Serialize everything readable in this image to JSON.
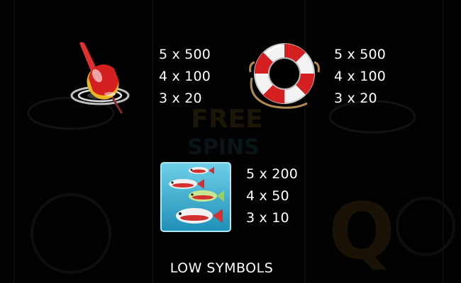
{
  "symbols": [
    {
      "name": "fishing-bobber",
      "icon": "fishing-bobber-icon",
      "payouts": [
        "5 x 500",
        "4 x 100",
        "3 x 20"
      ]
    },
    {
      "name": "life-ring",
      "icon": "life-ring-icon",
      "payouts": [
        "5 x 500",
        "4 x 100",
        "3 x 20"
      ]
    },
    {
      "name": "fish-tank",
      "icon": "fish-tank-icon",
      "payouts": [
        "5 x 200",
        "4 x 50",
        "3 x 10"
      ]
    }
  ],
  "footer": {
    "title": "LOW SYMBOLS"
  },
  "background_watermark": {
    "text": [
      "FREE",
      "SPINS"
    ],
    "letter": "Q"
  },
  "colors": {
    "background": "#000000",
    "text": "#ffffff",
    "accent_red": "#d42020",
    "accent_gold": "#e8b820",
    "water_blue": "#3fb8d6"
  }
}
